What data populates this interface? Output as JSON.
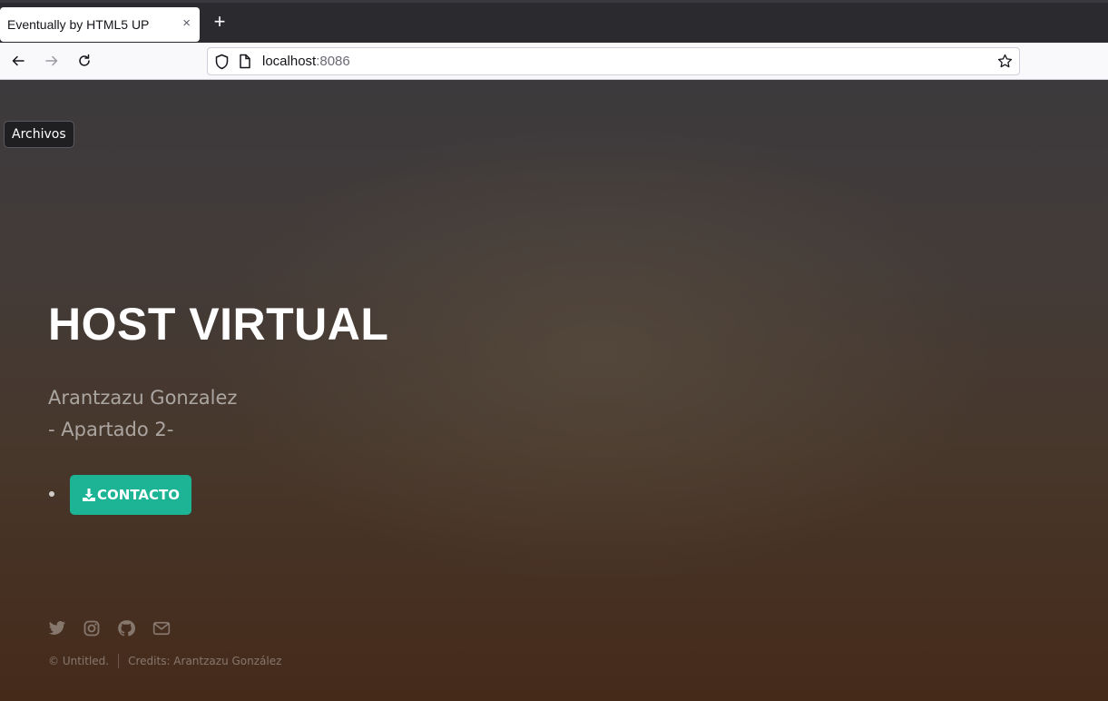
{
  "browser": {
    "tab_title": "Eventually by HTML5 UP",
    "tab_close": "×",
    "new_tab": "+",
    "url_host": "localhost",
    "url_port": ":8086",
    "icons": [
      "back-arrow-icon",
      "forward-arrow-icon",
      "reload-icon",
      "shield-icon",
      "page-icon",
      "bookmark-star-icon"
    ]
  },
  "page": {
    "archivos_button": "Archivos",
    "title": "HOST VIRTUAL",
    "subtitle_line1": "Arantzazu Gonzalez",
    "subtitle_line2": "- Apartado 2-",
    "contact_button": "CONTACTO",
    "contact_button_color": "#1cb495",
    "social_icons": [
      "twitter-icon",
      "instagram-icon",
      "github-icon",
      "envelope-icon"
    ],
    "footer_copyright": "© Untitled.",
    "footer_credits": "Credits: Arantzazu González"
  }
}
